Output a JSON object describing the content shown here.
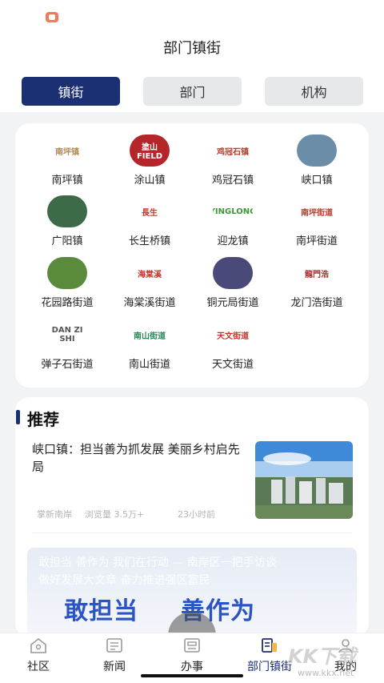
{
  "header": {
    "title": "部门镇街"
  },
  "tabs": [
    {
      "label": "镇街",
      "active": true
    },
    {
      "label": "部门",
      "active": false
    },
    {
      "label": "机构",
      "active": false
    }
  ],
  "grid": [
    {
      "label": "南坪镇",
      "logo_text": "南坪镇",
      "icon": "nanping-town-logo",
      "bg": "#ffffff",
      "fg": "#b88a4a"
    },
    {
      "label": "涂山镇",
      "logo_text": "塗山 FIELD",
      "icon": "tushan-town-logo",
      "bg": "#b5262a",
      "fg": "#ffffff"
    },
    {
      "label": "鸡冠石镇",
      "logo_text": "鸡冠石镇",
      "icon": "jiguanshi-town-logo",
      "bg": "#ffffff",
      "fg": "#c0392b"
    },
    {
      "label": "峡口镇",
      "logo_text": "",
      "icon": "xiakou-town-photo",
      "bg": "#6c8da8",
      "fg": "#ffffff"
    },
    {
      "label": "广阳镇",
      "logo_text": "",
      "icon": "guangyang-town-photo",
      "bg": "#3d6b4a",
      "fg": "#ffffff"
    },
    {
      "label": "长生桥镇",
      "logo_text": "長生",
      "icon": "changshengqiao-town-logo",
      "bg": "#ffffff",
      "fg": "#c0392b"
    },
    {
      "label": "迎龙镇",
      "logo_text": "YINGLONG",
      "icon": "yinglong-town-logo",
      "bg": "#ffffff",
      "fg": "#3a9a3a"
    },
    {
      "label": "南坪街道",
      "logo_text": "南坪街道",
      "icon": "nanping-street-logo",
      "bg": "#ffffff",
      "fg": "#c0392b"
    },
    {
      "label": "花园路街道",
      "logo_text": "",
      "icon": "huayuanlu-street-photo",
      "bg": "#5a8a3c",
      "fg": "#ffffff"
    },
    {
      "label": "海棠溪街道",
      "logo_text": "海棠溪",
      "icon": "haitangxi-street-logo",
      "bg": "#ffffff",
      "fg": "#c0392b"
    },
    {
      "label": "铜元局街道",
      "logo_text": "",
      "icon": "tongyuanju-street-photo",
      "bg": "#4a4a7a",
      "fg": "#ffffff"
    },
    {
      "label": "龙门浩街道",
      "logo_text": "龍門浩",
      "icon": "longmenhao-street-logo",
      "bg": "#ffffff",
      "fg": "#a33"
    },
    {
      "label": "弹子石街道",
      "logo_text": "DAN ZI SHI",
      "icon": "danzishi-street-logo",
      "bg": "#ffffff",
      "fg": "#555"
    },
    {
      "label": "南山街道",
      "logo_text": "南山街道",
      "icon": "nanshan-street-logo",
      "bg": "#ffffff",
      "fg": "#2a8a5a"
    },
    {
      "label": "天文街道",
      "logo_text": "天文街道",
      "icon": "tianwen-street-logo",
      "bg": "#ffffff",
      "fg": "#c0392b"
    }
  ],
  "recommend": {
    "section_title": "推荐",
    "article": {
      "title": "峡口镇：担当善为抓发展 美丽乡村启先局",
      "source": "掌新南岸",
      "views": "浏览量 3.5万+",
      "time": "23小时前"
    },
    "banner": {
      "ghost_line1": "敢担当 善作为 我们在行动 — 南岸区一把手访谈",
      "ghost_line2": "做好发展大文章 奋力推进强区富民",
      "big_left": "敢担当",
      "big_right": "善作为"
    }
  },
  "tabbar": [
    {
      "label": "社区",
      "icon": "community-icon",
      "active": false
    },
    {
      "label": "新闻",
      "icon": "news-icon",
      "active": false
    },
    {
      "label": "办事",
      "icon": "service-icon",
      "active": false
    },
    {
      "label": "部门镇街",
      "icon": "department-icon",
      "active": true
    },
    {
      "label": "我的",
      "icon": "profile-icon",
      "active": false
    }
  ],
  "watermark": {
    "text": "KK下载",
    "url": "www.kkx.net"
  },
  "colors": {
    "primary": "#1b2f73",
    "tab_inactive": "#e7e8ea",
    "status_icon": "#f07b5a"
  }
}
